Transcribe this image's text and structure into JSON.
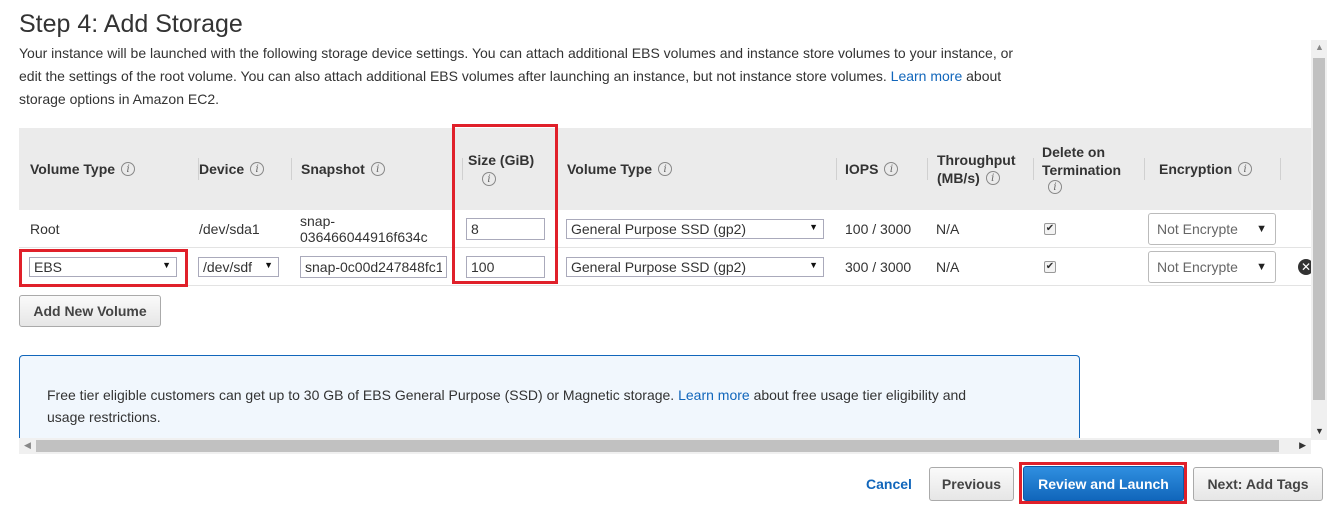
{
  "page": {
    "title": "Step 4: Add Storage",
    "intro_line1": "Your instance will be launched with the following storage device settings. You can attach additional EBS volumes and instance store volumes to your instance, or",
    "intro_line2": "edit the settings of the root volume. You can also attach additional EBS volumes after launching an instance, but not instance store volumes.",
    "intro_link": "Learn more",
    "intro_after_link": "about",
    "intro_line3": "storage options in Amazon EC2."
  },
  "table": {
    "headers": {
      "volume_type": "Volume Type",
      "device": "Device",
      "snapshot": "Snapshot",
      "size_line1": "Size (GiB)",
      "ebs_volume_type": "Volume Type",
      "iops": "IOPS",
      "throughput_line1": "Throughput",
      "throughput_line2": "(MB/s)",
      "delete_line1": "Delete on",
      "delete_line2": "Termination",
      "encryption": "Encryption"
    },
    "rows": [
      {
        "volume_type": "Root",
        "device": "/dev/sda1",
        "snapshot_line1": "snap-",
        "snapshot_line2": "036466044916f634c",
        "size": "8",
        "ebs_volume_type": "General Purpose SSD (gp2)",
        "iops": "100 / 3000",
        "throughput": "N/A",
        "delete_on_termination": "✔",
        "encryption": "Not Encrypte"
      },
      {
        "volume_type": "EBS",
        "device": "/dev/sdf",
        "snapshot": "snap-0c00d247848fc1",
        "size": "100",
        "ebs_volume_type": "General Purpose SSD (gp2)",
        "iops": "300 / 3000",
        "throughput": "N/A",
        "delete_on_termination": "✔",
        "encryption": "Not Encrypte",
        "remove": "✕"
      }
    ],
    "add_volume_button": "Add New Volume"
  },
  "notice": {
    "text_before_link": "Free tier eligible customers can get up to 30 GB of EBS General Purpose (SSD) or Magnetic storage.",
    "link": "Learn more",
    "text_after_link": "about free usage tier eligibility and",
    "line2": "usage restrictions."
  },
  "footer": {
    "cancel": "Cancel",
    "previous": "Previous",
    "review_and_launch": "Review and Launch",
    "next": "Next: Add Tags"
  },
  "icons": {
    "info": "info-icon",
    "dropdown": "chevron-down-icon",
    "remove": "close-circle-icon"
  },
  "colors": {
    "link": "#1166bb",
    "primary_button": "#1166bb",
    "highlight": "#e0202a",
    "header_bg": "#ebebeb",
    "notice_bg": "#f1f7fd"
  }
}
